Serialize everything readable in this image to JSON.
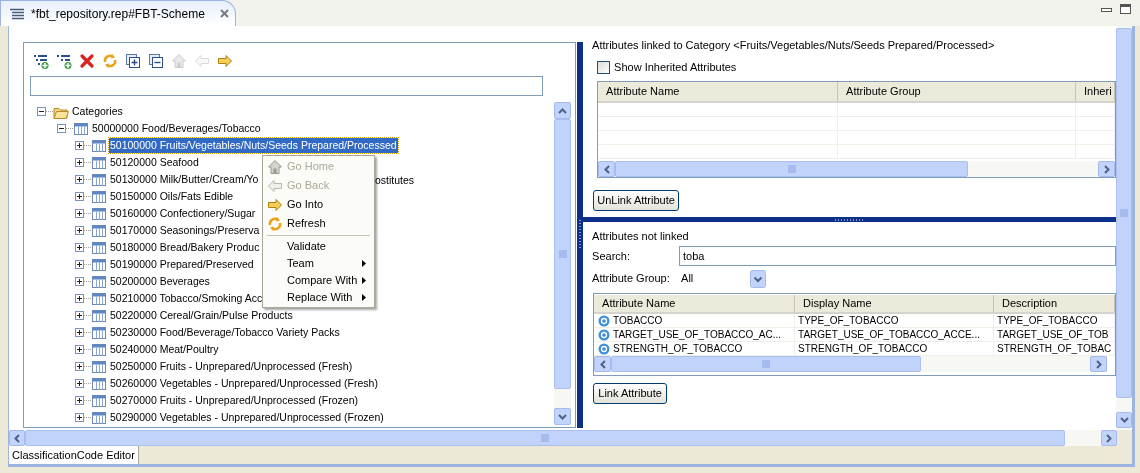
{
  "editor_tab": {
    "title": "*fbt_repository.rep#FBT-Scheme"
  },
  "toolbar": [
    {
      "kind": "add-sibling",
      "disabled": false
    },
    {
      "kind": "add-child",
      "disabled": false
    },
    {
      "kind": "delete",
      "disabled": false
    },
    {
      "kind": "refresh",
      "disabled": false
    },
    {
      "kind": "expand-all",
      "disabled": false
    },
    {
      "kind": "collapse-all",
      "disabled": false
    },
    {
      "kind": "home",
      "disabled": true
    },
    {
      "kind": "back",
      "disabled": true
    },
    {
      "kind": "forward",
      "disabled": false
    }
  ],
  "tree": [
    {
      "label": "Categories",
      "kind": "folder",
      "expanded": true,
      "selected": false,
      "children": [
        {
          "label": "50000000 Food/Beverages/Tobacco",
          "kind": "table",
          "expanded": true,
          "selected": false,
          "children": [
            {
              "label": "50100000 Fruits/Vegetables/Nuts/Seeds Prepared/Processed",
              "kind": "table",
              "expanded": false,
              "selected": true
            },
            {
              "label": "50120000 Seafood",
              "kind": "table",
              "expanded": false,
              "selected": false
            },
            {
              "label": "50130000 Milk/Butter/Cream/Yo",
              "tail": "ostitutes",
              "kind": "table",
              "expanded": false,
              "selected": false
            },
            {
              "label": "50150000 Oils/Fats Edible",
              "kind": "table",
              "expanded": false,
              "selected": false
            },
            {
              "label": "50160000 Confectionery/Sugar",
              "kind": "table",
              "expanded": false,
              "selected": false
            },
            {
              "label": "50170000 Seasonings/Preserva",
              "kind": "table",
              "expanded": false,
              "selected": false
            },
            {
              "label": "50180000 Bread/Bakery Produc",
              "kind": "table",
              "expanded": false,
              "selected": false
            },
            {
              "label": "50190000 Prepared/Preserved",
              "kind": "table",
              "expanded": false,
              "selected": false
            },
            {
              "label": "50200000 Beverages",
              "kind": "table",
              "expanded": false,
              "selected": false
            },
            {
              "label": "50210000 Tobacco/Smoking Acc",
              "kind": "table",
              "expanded": false,
              "selected": false
            },
            {
              "label": "50220000 Cereal/Grain/Pulse Products",
              "kind": "table",
              "expanded": false,
              "selected": false
            },
            {
              "label": "50230000 Food/Beverage/Tobacco Variety Packs",
              "kind": "table",
              "expanded": false,
              "selected": false
            },
            {
              "label": "50240000 Meat/Poultry",
              "kind": "table",
              "expanded": false,
              "selected": false
            },
            {
              "label": "50250000 Fruits - Unprepared/Unprocessed (Fresh)",
              "kind": "table",
              "expanded": false,
              "selected": false
            },
            {
              "label": "50260000 Vegetables - Unprepared/Unprocessed (Fresh)",
              "kind": "table",
              "expanded": false,
              "selected": false
            },
            {
              "label": "50270000 Fruits - Unprepared/Unprocessed (Frozen)",
              "kind": "table",
              "expanded": false,
              "selected": false
            },
            {
              "label": "50290000 Vegetables - Unprepared/Unprocessed (Frozen)",
              "kind": "table",
              "expanded": false,
              "selected": false
            }
          ]
        }
      ]
    }
  ],
  "context_menu": [
    {
      "kind": "home",
      "label": "Go Home",
      "disabled": true
    },
    {
      "kind": "back",
      "label": "Go Back",
      "disabled": true
    },
    {
      "kind": "forward",
      "label": "Go Into",
      "disabled": false
    },
    {
      "kind": "refresh",
      "label": "Refresh",
      "disabled": false
    },
    {
      "kind": "separator"
    },
    {
      "kind": "plain",
      "label": "Validate",
      "disabled": false
    },
    {
      "kind": "submenu",
      "label": "Team",
      "disabled": false
    },
    {
      "kind": "submenu",
      "label": "Compare With",
      "disabled": false
    },
    {
      "kind": "submenu",
      "label": "Replace With",
      "disabled": false
    }
  ],
  "linked": {
    "title": "Attributes linked to Category <Fruits/Vegetables/Nuts/Seeds Prepared/Processed>",
    "show_inherited": {
      "label": "Show Inherited Attributes",
      "checked": false
    },
    "columns": [
      "Attribute Name",
      "Attribute Group",
      "Inheri"
    ],
    "button": "UnLink Attribute"
  },
  "not_linked": {
    "title": "Attributes not linked",
    "search": {
      "label": "Search:",
      "value": "toba"
    },
    "group": {
      "label": "Attribute Group:",
      "value": "All"
    },
    "columns": [
      "Attribute Name",
      "Display Name",
      "Description"
    ],
    "rows": [
      [
        "TOBACCO",
        "TYPE_OF_TOBACCO",
        "TYPE_OF_TOBACCO"
      ],
      [
        "TARGET_USE_OF_TOBACCO_AC...",
        "TARGET_USE_OF_TOBACCO_ACCE...",
        "TARGET_USE_OF_TOB"
      ],
      [
        "STRENGTH_OF_TOBACCO",
        "STRENGTH_OF_TOBACCO",
        "STRENGTH_OF_TOBAC"
      ]
    ],
    "button": "Link Attribute"
  },
  "bottom_tab": {
    "title": "ClassificationCode Editor"
  }
}
